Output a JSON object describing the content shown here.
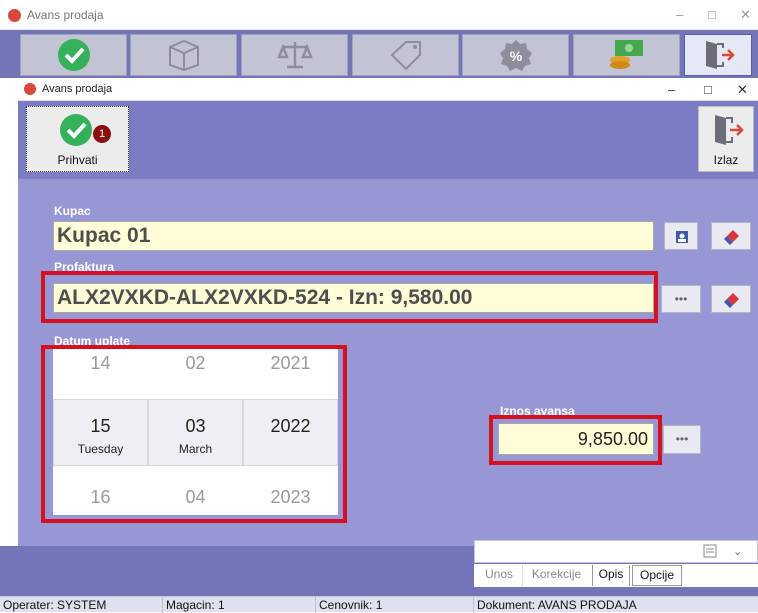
{
  "outer_window": {
    "title": "Avans prodaja",
    "controls": [
      "–",
      "□",
      "✕"
    ]
  },
  "dialog": {
    "title": "Avans prodaja",
    "controls": [
      "–",
      "□",
      "✕"
    ],
    "accept_label": "Prihvati",
    "accept_badge": "1",
    "exit_label": "Izlaz"
  },
  "form": {
    "customer_label": "Kupac",
    "customer_value": "Kupac 01",
    "proforma_label": "Profaktura",
    "proforma_value": "ALX2VXKD-ALX2VXKD-524 - Izn: 9,580.00",
    "date_label": "Datum uplate",
    "date_picker": {
      "prev": {
        "day": "14",
        "month": "02",
        "year": "2021"
      },
      "selected": {
        "day": "15",
        "weekday": "Tuesday",
        "month": "03",
        "month_name": "March",
        "year": "2022"
      },
      "next": {
        "day": "16",
        "month": "04",
        "year": "2023"
      }
    },
    "amount_label": "Iznos avansa",
    "amount_value": "9,850.00",
    "ellipsis": "•••"
  },
  "tabs": [
    "Unos",
    "Korekcije",
    "Opis",
    "Opcije"
  ],
  "active_tab": "Opis",
  "status_bar": {
    "operator": "Operater: SYSTEM",
    "warehouse": "Magacin: 1",
    "price_list": "Cenovnik: 1",
    "document": "Dokument: AVANS PRODAJA"
  },
  "colors": {
    "toolbar": "#7475b8",
    "dialog_bg": "#9797d5",
    "field_bg": "#fffdd7",
    "highlight": "#d4121f",
    "accent_green": "#34b15a",
    "badge": "#8b1010"
  }
}
